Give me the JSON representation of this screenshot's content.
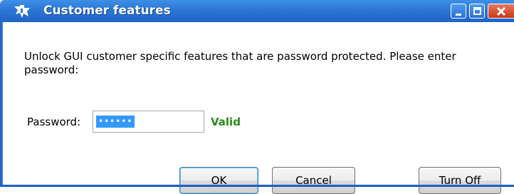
{
  "window": {
    "title": "Customer features",
    "controls": [
      "minimize-icon",
      "maximize-icon",
      "close-icon"
    ]
  },
  "dialog": {
    "message": "Unlock GUI customer specific features that are password protected.   Please enter password:",
    "password_label": "Password:",
    "password_value": "••••••",
    "status_text": "Valid",
    "status_color": "#2a8a1a"
  },
  "buttons": {
    "ok": "OK",
    "cancel": "Cancel",
    "turn_off": "Turn Off"
  },
  "colors": {
    "titlebar": "#2f78d5",
    "close_button": "#c9361a",
    "selection": "#3399ff"
  }
}
